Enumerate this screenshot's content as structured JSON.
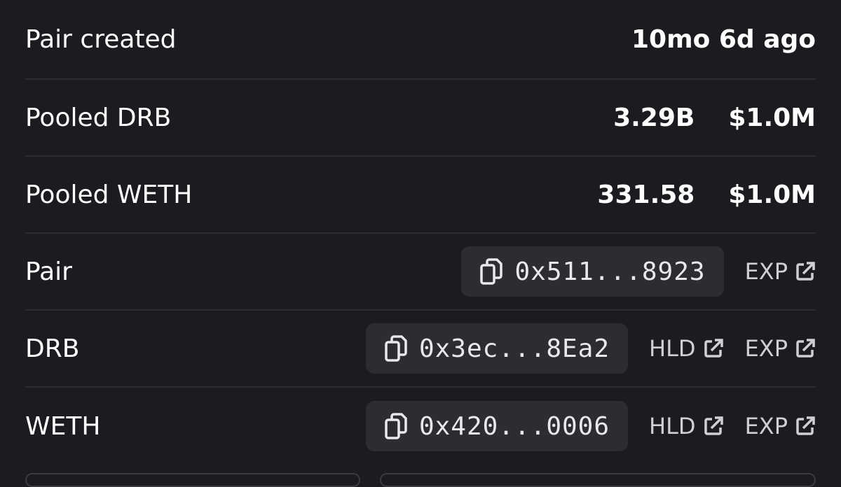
{
  "rows": [
    {
      "label": "Pair created",
      "values": [
        "10mo 6d ago"
      ]
    },
    {
      "label": "Pooled DRB",
      "values": [
        "3.29B",
        "$1.0M"
      ]
    },
    {
      "label": "Pooled WETH",
      "values": [
        "331.58",
        "$1.0M"
      ]
    }
  ],
  "addresses": [
    {
      "label": "Pair",
      "address": "0x511...8923",
      "links": [
        "EXP"
      ]
    },
    {
      "label": "DRB",
      "address": "0x3ec...8Ea2",
      "links": [
        "HLD",
        "EXP"
      ]
    },
    {
      "label": "WETH",
      "address": "0x420...0006",
      "links": [
        "HLD",
        "EXP"
      ]
    }
  ],
  "icons": {
    "copy": "copy-icon",
    "external": "external-link-icon"
  },
  "colors": {
    "background": "#1b1b20",
    "chip": "#2c2c32",
    "divider": "#2d2d33",
    "text": "#ffffff",
    "muted": "#cfcfd4"
  }
}
